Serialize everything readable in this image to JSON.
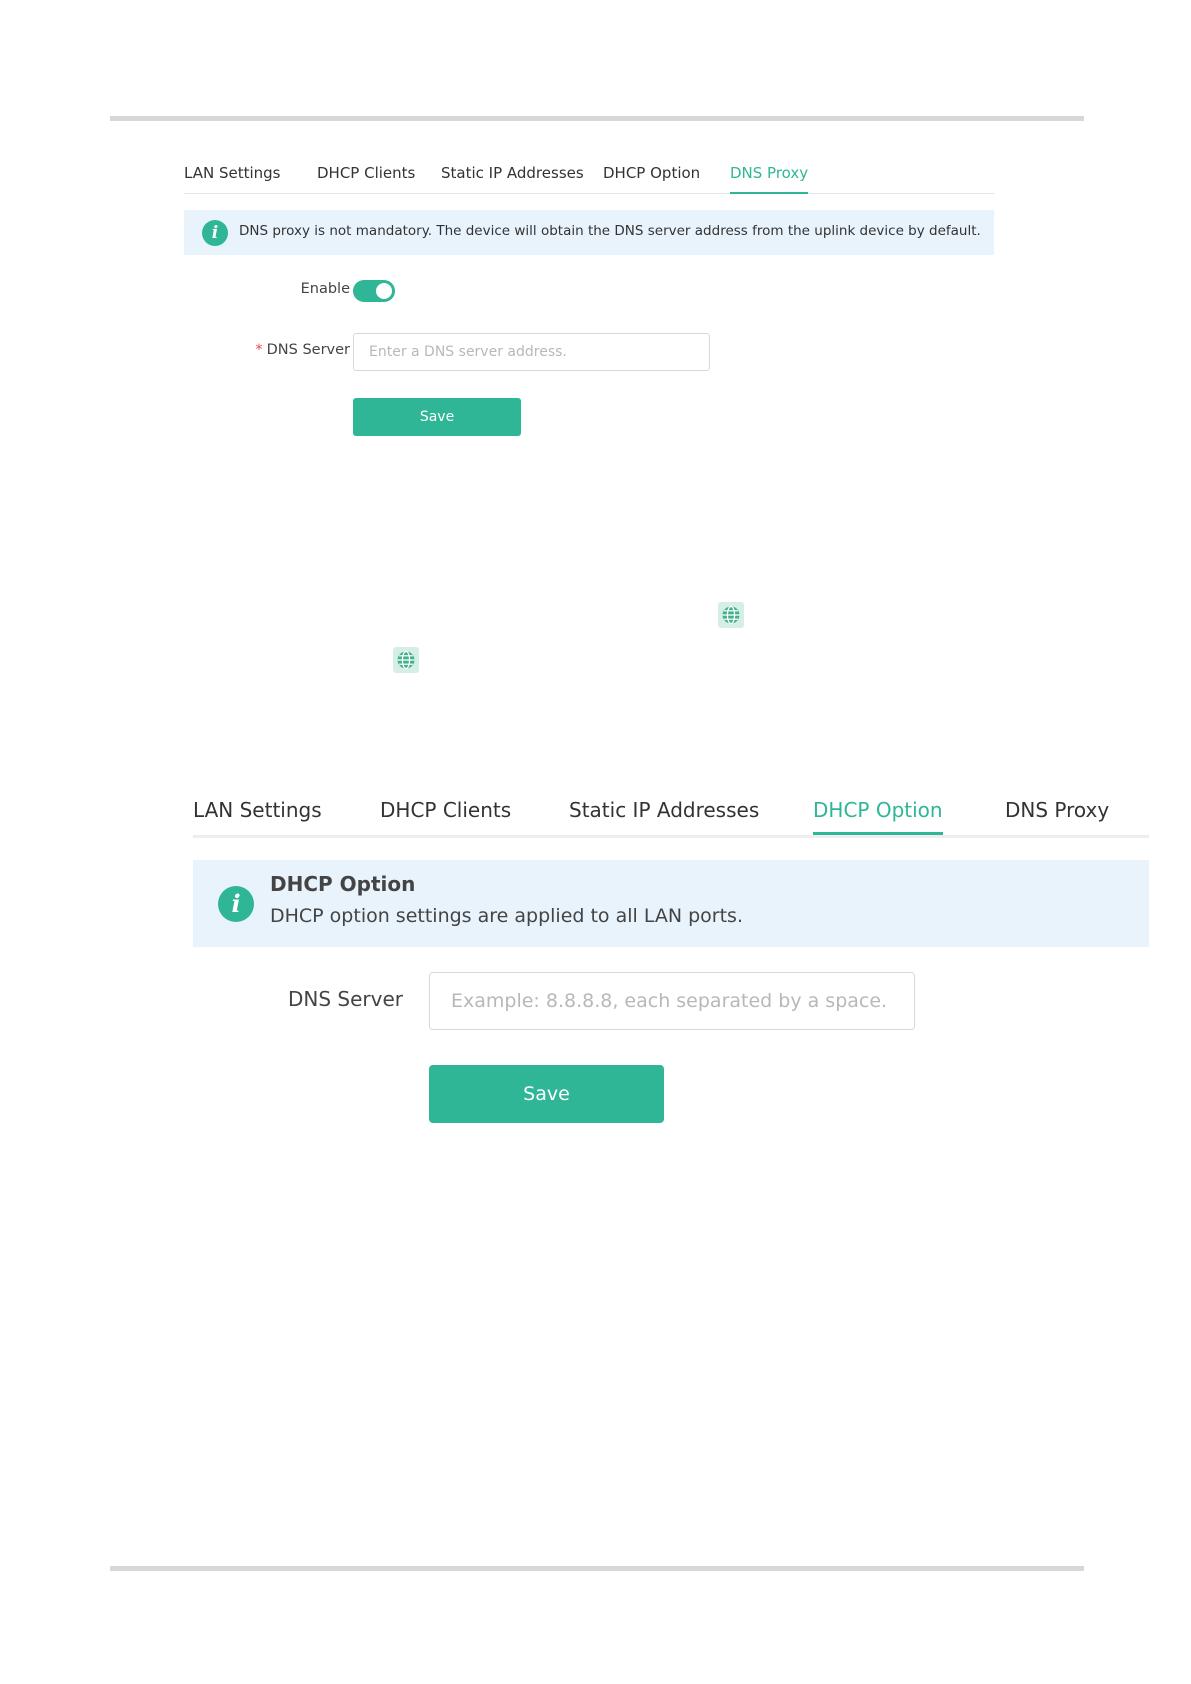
{
  "dns_proxy_panel": {
    "tabs": [
      {
        "label": "LAN Settings"
      },
      {
        "label": "DHCP Clients"
      },
      {
        "label": "Static IP Addresses"
      },
      {
        "label": "DHCP Option"
      },
      {
        "label": "DNS Proxy"
      }
    ],
    "active_tab": "DNS Proxy",
    "banner": {
      "icon": "info-icon",
      "message": "DNS proxy is not mandatory. The device will obtain the DNS server address from the uplink device by default."
    },
    "enable": {
      "label": "Enable",
      "checked": true
    },
    "dns_server": {
      "required_mark": "*",
      "label": "DNS Server",
      "value": "",
      "placeholder": "Enter a DNS server address."
    },
    "save_label": "Save"
  },
  "globe_icons": [
    "globe-icon",
    "globe-icon"
  ],
  "dhcp_option_panel": {
    "tabs": [
      {
        "label": "LAN Settings"
      },
      {
        "label": "DHCP Clients"
      },
      {
        "label": "Static IP Addresses"
      },
      {
        "label": "DHCP Option"
      },
      {
        "label": "DNS Proxy"
      }
    ],
    "active_tab": "DHCP Option",
    "banner": {
      "icon": "info-icon",
      "title": "DHCP Option",
      "message": "DHCP option settings are applied to all LAN ports."
    },
    "dns_server": {
      "label": "DNS Server",
      "value": "",
      "placeholder": "Example: 8.8.8.8, each separated by a space."
    },
    "save_label": "Save"
  },
  "colors": {
    "accent": "#2fb696",
    "banner_bg": "#e8f3fc",
    "required": "#e94a4a"
  }
}
